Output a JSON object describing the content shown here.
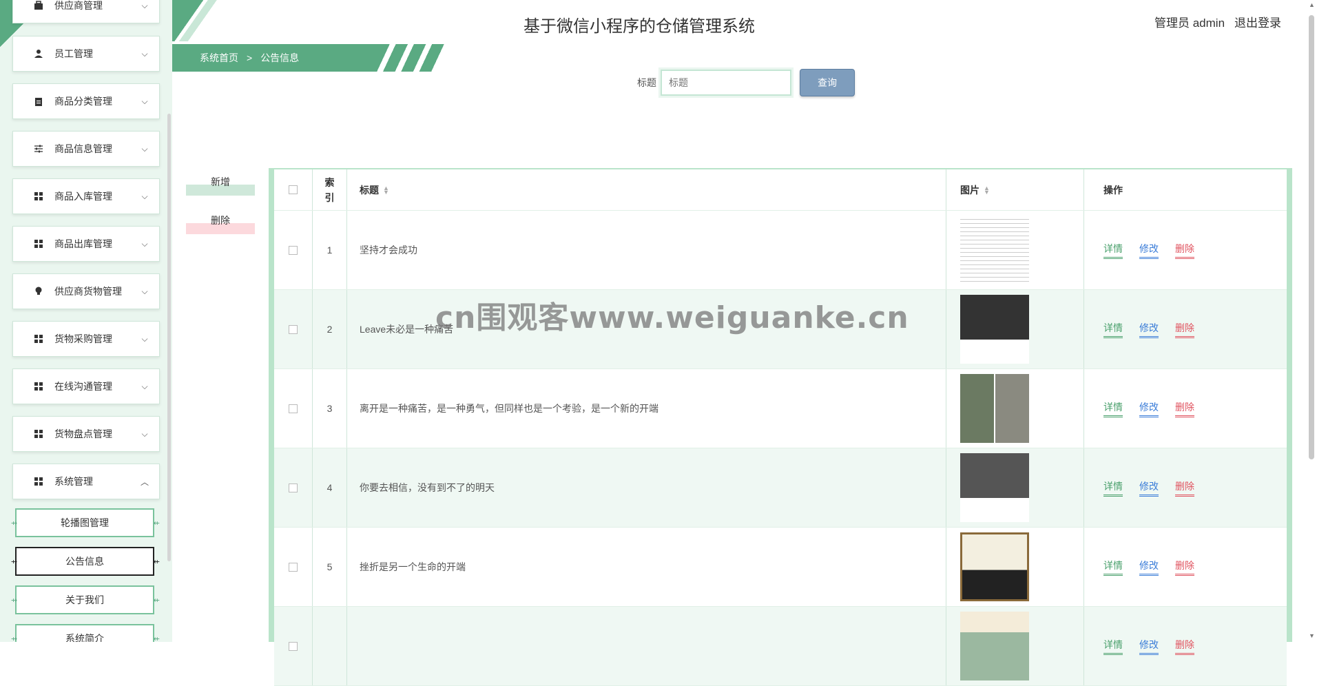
{
  "header": {
    "system_title": "基于微信小程序的仓储管理系统",
    "user_label": "管理员 admin",
    "logout_label": "退出登录"
  },
  "breadcrumb": {
    "home": "系统首页",
    "separator": ">",
    "current": "公告信息"
  },
  "search": {
    "label": "标题",
    "placeholder": "标题",
    "button": "查询"
  },
  "actions": {
    "add": "新增",
    "delete": "删除"
  },
  "sidebar": {
    "items": [
      {
        "label": "供应商管理",
        "icon": "briefcase-icon"
      },
      {
        "label": "员工管理",
        "icon": "user-icon"
      },
      {
        "label": "商品分类管理",
        "icon": "clipboard-icon"
      },
      {
        "label": "商品信息管理",
        "icon": "sliders-icon"
      },
      {
        "label": "商品入库管理",
        "icon": "grid-icon"
      },
      {
        "label": "商品出库管理",
        "icon": "grid-icon"
      },
      {
        "label": "供应商货物管理",
        "icon": "bulb-icon"
      },
      {
        "label": "货物采购管理",
        "icon": "grid-icon"
      },
      {
        "label": "在线沟通管理",
        "icon": "grid-icon"
      },
      {
        "label": "货物盘点管理",
        "icon": "grid-icon"
      },
      {
        "label": "系统管理",
        "icon": "grid-icon"
      }
    ],
    "sub_items": [
      {
        "label": "轮播图管理"
      },
      {
        "label": "公告信息"
      },
      {
        "label": "关于我们"
      },
      {
        "label": "系统简介"
      }
    ]
  },
  "table": {
    "columns": {
      "index": "索引",
      "title": "标题",
      "image": "图片",
      "ops": "操作"
    },
    "op_labels": {
      "detail": "详情",
      "edit": "修改",
      "delete": "删除"
    },
    "rows": [
      {
        "index": "1",
        "title": "坚持才会成功"
      },
      {
        "index": "2",
        "title": "Leave未必是一种痛苦"
      },
      {
        "index": "3",
        "title": "离开是一种痛苦，是一种勇气，但同样也是一个考验，是一个新的开端"
      },
      {
        "index": "4",
        "title": "你要去相信，没有到不了的明天"
      },
      {
        "index": "5",
        "title": "挫折是另一个生命的开端"
      },
      {
        "index": "",
        "title": ""
      }
    ]
  },
  "watermark": "cn围观客www.weiguanke.cn",
  "colors": {
    "accent": "#5aaa82",
    "detail": "#4aa06c",
    "edit": "#3b7dd8",
    "delete": "#e0535f",
    "search_button": "#7e9dbd"
  }
}
